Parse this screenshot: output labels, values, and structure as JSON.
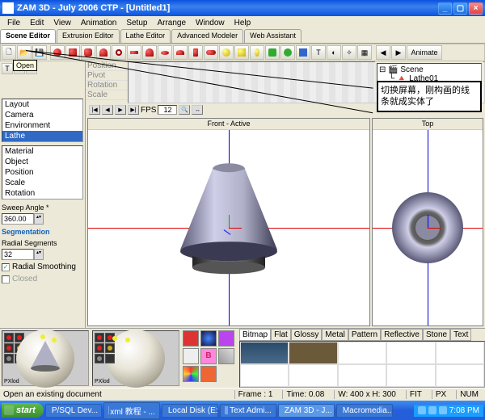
{
  "title": "ZAM 3D - July 2006 CTP - [Untitled1]",
  "menu": [
    "File",
    "Edit",
    "View",
    "Animation",
    "Setup",
    "Arrange",
    "Window",
    "Help"
  ],
  "editor_tabs": [
    "Scene Editor",
    "Extrusion Editor",
    "Lathe Editor",
    "Advanced Modeler",
    "Web Assistant"
  ],
  "active_tab": "Scene Editor",
  "open_tooltip": "Open",
  "left_list_a": [
    "Layout",
    "Camera",
    "Environment",
    "Lathe"
  ],
  "left_list_a_sel": "Lathe",
  "left_list_b": [
    "Material",
    "Object",
    "Position",
    "Scale",
    "Rotation"
  ],
  "sweep_label": "Sweep Angle *",
  "sweep_value": "360.00",
  "segmentation_header": "Segmentation",
  "radial_label": "Radial Segments",
  "radial_value": "32",
  "chk_smooth": "Radial Smoothing",
  "chk_smooth_on": true,
  "chk_closed": "Closed",
  "chk_closed_on": false,
  "timeline_rows": [
    "Position",
    "Pivot",
    "Rotation",
    "Scale"
  ],
  "fps_label": "FPS",
  "fps_value": "12",
  "viewport_front": "Front - Active",
  "viewport_top": "Top",
  "scene_root": "Scene",
  "scene_child": "Lathe01",
  "annotation": "切换屏幕，刚构画的线条就成实体了",
  "mat_tabs": [
    "Bitmap",
    "Flat",
    "Glossy",
    "Metal",
    "Pattern",
    "Reflective",
    "Stone",
    "Text"
  ],
  "mat_tab_active": "Bitmap",
  "animate_btn": "Animate",
  "preview_label": "PXlod",
  "status_left": "Open an existing document",
  "status_frame": "Frame : 1",
  "status_time": "Time: 0.08",
  "status_dim": "W: 400 x H: 300",
  "status_fit": "FIT",
  "status_px": "PX",
  "status_num": "NUM",
  "start": "start",
  "tasks": [
    "P/SQL Dev...",
    "xml 教程 - ...",
    "Local Disk (E:)",
    "Text Admi...",
    "ZAM 3D - J...",
    "Macromedia..."
  ],
  "clock": "7:08 PM"
}
